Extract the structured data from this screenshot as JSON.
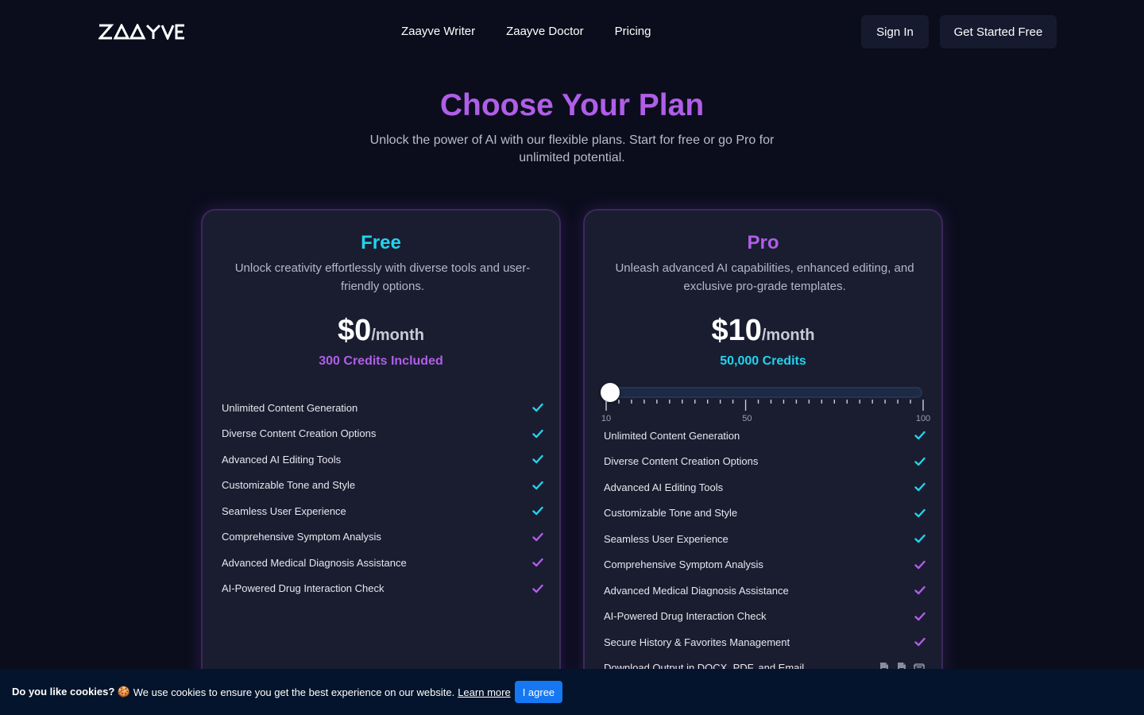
{
  "header": {
    "logo_text": "ZAAYVE",
    "nav": [
      "Zaayve Writer",
      "Zaayve Doctor",
      "Pricing"
    ],
    "sign_in": "Sign In",
    "get_started": "Get Started Free"
  },
  "hero": {
    "title": "Choose Your Plan",
    "subtitle": "Unlock the power of AI with our flexible plans. Start for free or go Pro for unlimited potential."
  },
  "plans": {
    "free": {
      "name": "Free",
      "description": "Unlock creativity effortlessly with diverse tools and user-friendly options.",
      "price": "$0",
      "period": "/month",
      "credits": "300 Credits Included",
      "features": [
        {
          "label": "Unlimited Content Generation",
          "check_color": "#22d3ee"
        },
        {
          "label": "Diverse Content Creation Options",
          "check_color": "#22d3ee"
        },
        {
          "label": "Advanced AI Editing Tools",
          "check_color": "#22d3ee"
        },
        {
          "label": "Customizable Tone and Style",
          "check_color": "#22d3ee"
        },
        {
          "label": "Seamless User Experience",
          "check_color": "#22d3ee"
        },
        {
          "label": "Comprehensive Symptom Analysis",
          "check_color": "#b05ee8"
        },
        {
          "label": "Advanced Medical Diagnosis Assistance",
          "check_color": "#b05ee8"
        },
        {
          "label": "AI-Powered Drug Interaction Check",
          "check_color": "#b05ee8"
        }
      ]
    },
    "pro": {
      "name": "Pro",
      "description": "Unleash advanced AI capabilities, enhanced editing, and exclusive pro-grade templates.",
      "price": "$10",
      "period": "/month",
      "credits": "50,000 Credits",
      "slider": {
        "min": 10,
        "max": 100,
        "value": 10,
        "labels": [
          "10",
          "50",
          "100"
        ]
      },
      "features": [
        {
          "label": "Unlimited Content Generation",
          "check_color": "#22d3ee"
        },
        {
          "label": "Diverse Content Creation Options",
          "check_color": "#22d3ee"
        },
        {
          "label": "Advanced AI Editing Tools",
          "check_color": "#22d3ee"
        },
        {
          "label": "Customizable Tone and Style",
          "check_color": "#22d3ee"
        },
        {
          "label": "Seamless User Experience",
          "check_color": "#22d3ee"
        },
        {
          "label": "Comprehensive Symptom Analysis",
          "check_color": "#b05ee8"
        },
        {
          "label": "Advanced Medical Diagnosis Assistance",
          "check_color": "#b05ee8"
        },
        {
          "label": "AI-Powered Drug Interaction Check",
          "check_color": "#b05ee8"
        },
        {
          "label": "Secure History & Favorites Management",
          "check_color": "#b05ee8"
        },
        {
          "label": "Download Output in DOCX, PDF, and Email",
          "icons": [
            "docx-file-icon",
            "pdf-file-icon",
            "email-icon"
          ]
        }
      ]
    }
  },
  "cookie": {
    "question": "Do you like cookies? 🍪",
    "text": "We use cookies to ensure you get the best experience on our website.",
    "link": "Learn more",
    "button": "I agree"
  },
  "colors": {
    "background": "#0b0d1c",
    "card": "#1a1d30",
    "accent_purple": "#b05ee8",
    "accent_cyan": "#22d3ee",
    "cookie_bar": "#04142c",
    "cookie_button": "#1677f2"
  }
}
